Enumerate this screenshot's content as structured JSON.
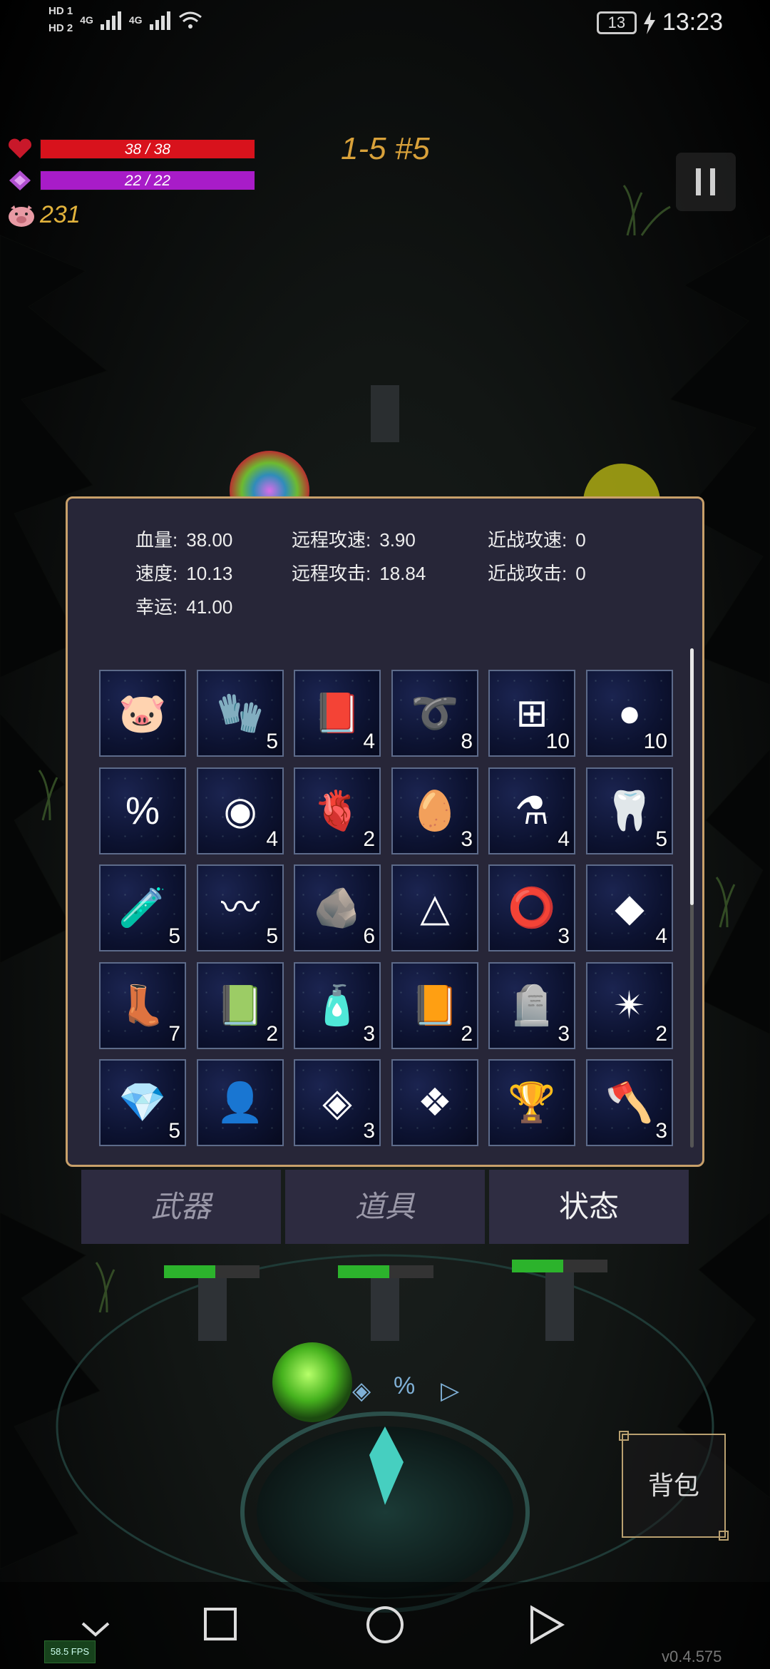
{
  "status_bar": {
    "sim1": "HD 1",
    "sim2": "HD 2",
    "network1": "4G",
    "network2": "4G",
    "battery": "13",
    "time": "13:23"
  },
  "hud": {
    "hp_text": "38 / 38",
    "hp_fraction": 1.0,
    "mp_text": "22 / 22",
    "mp_fraction": 1.0,
    "gold": "231",
    "level": "1-5 #5",
    "colors": {
      "hp": "#d8121c",
      "mp": "#a81cc8",
      "gold": "#e2b33c"
    }
  },
  "stats": {
    "hp_label": "血量:",
    "hp_value": "38.00",
    "speed_label": "速度:",
    "speed_value": "10.13",
    "luck_label": "幸运:",
    "luck_value": "41.00",
    "ranged_speed_label": "远程攻速:",
    "ranged_speed_value": "3.90",
    "ranged_attack_label": "远程攻击:",
    "ranged_attack_value": "18.84",
    "melee_speed_label": "近战攻速:",
    "melee_speed_value": "0",
    "melee_attack_label": "近战攻击:",
    "melee_attack_value": "0"
  },
  "items": [
    {
      "icon": "pig-icon",
      "glyph": "🐷",
      "count": ""
    },
    {
      "icon": "gloves-icon",
      "glyph": "🧤",
      "count": "5"
    },
    {
      "icon": "book-icon",
      "glyph": "📕",
      "count": "4"
    },
    {
      "icon": "thorn-ring-icon",
      "glyph": "➰",
      "count": "8"
    },
    {
      "icon": "medkit-icon",
      "glyph": "⊞",
      "count": "10"
    },
    {
      "icon": "gold-coin-icon",
      "glyph": "●",
      "count": "10"
    },
    {
      "icon": "percent-rune-icon",
      "glyph": "%",
      "count": ""
    },
    {
      "icon": "rainbow-orb-icon",
      "glyph": "◉",
      "count": "4"
    },
    {
      "icon": "heart-icon",
      "glyph": "🫀",
      "count": "2"
    },
    {
      "icon": "egg-icon",
      "glyph": "🥚",
      "count": "3"
    },
    {
      "icon": "blue-potion-icon",
      "glyph": "⚗",
      "count": "4"
    },
    {
      "icon": "fang-icon",
      "glyph": "🦷",
      "count": "5"
    },
    {
      "icon": "flask-icon",
      "glyph": "🧪",
      "count": "5"
    },
    {
      "icon": "worm-icon",
      "glyph": "〰",
      "count": "5"
    },
    {
      "icon": "rock-icon",
      "glyph": "🪨",
      "count": "6"
    },
    {
      "icon": "triangle-rune-icon",
      "glyph": "△",
      "count": ""
    },
    {
      "icon": "rings-icon",
      "glyph": "⭕",
      "count": "3"
    },
    {
      "icon": "ore-icon",
      "glyph": "◆",
      "count": "4"
    },
    {
      "icon": "boots-icon",
      "glyph": "👢",
      "count": "7"
    },
    {
      "icon": "skull-book-icon",
      "glyph": "📗",
      "count": "2"
    },
    {
      "icon": "green-potion-icon",
      "glyph": "🧴",
      "count": "3"
    },
    {
      "icon": "red-book-icon",
      "glyph": "📙",
      "count": "2"
    },
    {
      "icon": "tombstone-icon",
      "glyph": "🪦",
      "count": "3"
    },
    {
      "icon": "star-crystal-icon",
      "glyph": "✴",
      "count": "2"
    },
    {
      "icon": "crystal-icon",
      "glyph": "💎",
      "count": "5"
    },
    {
      "icon": "cloak-icon",
      "glyph": "👤",
      "count": ""
    },
    {
      "icon": "diamond-frame-icon",
      "glyph": "◈",
      "count": "3"
    },
    {
      "icon": "cross-frame-icon",
      "glyph": "❖",
      "count": ""
    },
    {
      "icon": "star-trophy-icon",
      "glyph": "🏆",
      "count": ""
    },
    {
      "icon": "axe-icon",
      "glyph": "🪓",
      "count": "3"
    }
  ],
  "tabs": [
    {
      "label": "武器",
      "active": false
    },
    {
      "label": "道具",
      "active": false
    },
    {
      "label": "状态",
      "active": true
    }
  ],
  "backpack_label": "背包",
  "fps": "58.5 FPS",
  "version": "v0.4.575"
}
